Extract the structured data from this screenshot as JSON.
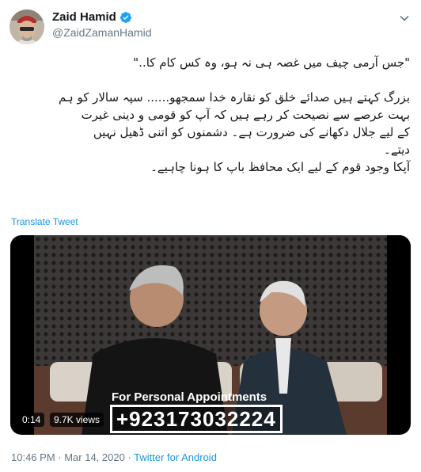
{
  "author": {
    "display_name": "Zaid Hamid",
    "handle": "@ZaidZamanHamid",
    "verified_icon": "verified-badge-icon",
    "verified_color": "#1da1f2"
  },
  "tweet": {
    "lines": [
      "\"جس آرمی چیف میں غصہ ہی نہ ہو، وہ کس کام کا..\"",
      "",
      "بزرگ کہتے ہیں صدائے خلق کو نقارہ خدا سمجھو...... سپہ سالار کو ہم",
      "بہت عرصے سے نصیحت کر رہے ہیں کہ آپ کو قومی و دینی غیرت",
      "کے لیے جلال دکھانے کی ضرورت ہے۔ دشمنوں کو اتنی ڈھیل نہیں",
      "دیتے۔",
      "آپکا وجود قوم کے لیے ایک محافظ باپ کا ہونا چاہیے۔"
    ],
    "translate_label": "Translate Tweet"
  },
  "media": {
    "overlay_caption": "For Personal Appointments",
    "overlay_phone": "+923173032224",
    "duration": "0:14",
    "views": "9.7K views"
  },
  "footer": {
    "time": "10:46 PM",
    "separator1": " · ",
    "date": "Mar 14, 2020",
    "separator2": " · ",
    "source": "Twitter for Android"
  },
  "colors": {
    "link": "#1b95e0",
    "secondary_text": "#657786"
  }
}
